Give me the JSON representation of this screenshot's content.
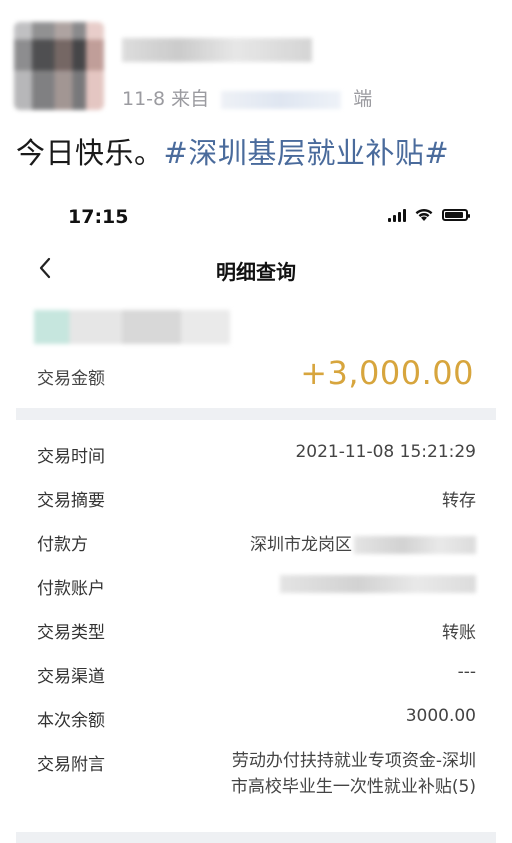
{
  "post": {
    "meta_prefix": "11-8",
    "meta_source": "来自",
    "meta_suffix": "端",
    "text_plain": "今日快乐。",
    "hashtag": "#深圳基层就业补贴#"
  },
  "phone": {
    "status": {
      "time": "17:15"
    },
    "nav": {
      "title": "明细查询",
      "back_icon": "chevron-left-icon"
    },
    "amount": {
      "label": "交易金额",
      "value": "+3,000.00",
      "color": "#d7a53d"
    },
    "details": [
      {
        "label": "交易时间",
        "value": "2021-11-08 15:21:29"
      },
      {
        "label": "交易摘要",
        "value": "转存"
      },
      {
        "label": "付款方",
        "value": "深圳市龙岗区"
      },
      {
        "label": "付款账户",
        "value": ""
      },
      {
        "label": "交易类型",
        "value": "转账"
      },
      {
        "label": "交易渠道",
        "value": "---"
      },
      {
        "label": "本次余额",
        "value": "3000.00"
      },
      {
        "label": "交易附言",
        "value": "劳动办付扶持就业专项资金-深圳市高校毕业生一次性就业补贴(5)"
      }
    ]
  },
  "colors": {
    "hashtag": "#4a6b9c",
    "amount": "#d7a53d",
    "divider": "#eef0f3"
  }
}
